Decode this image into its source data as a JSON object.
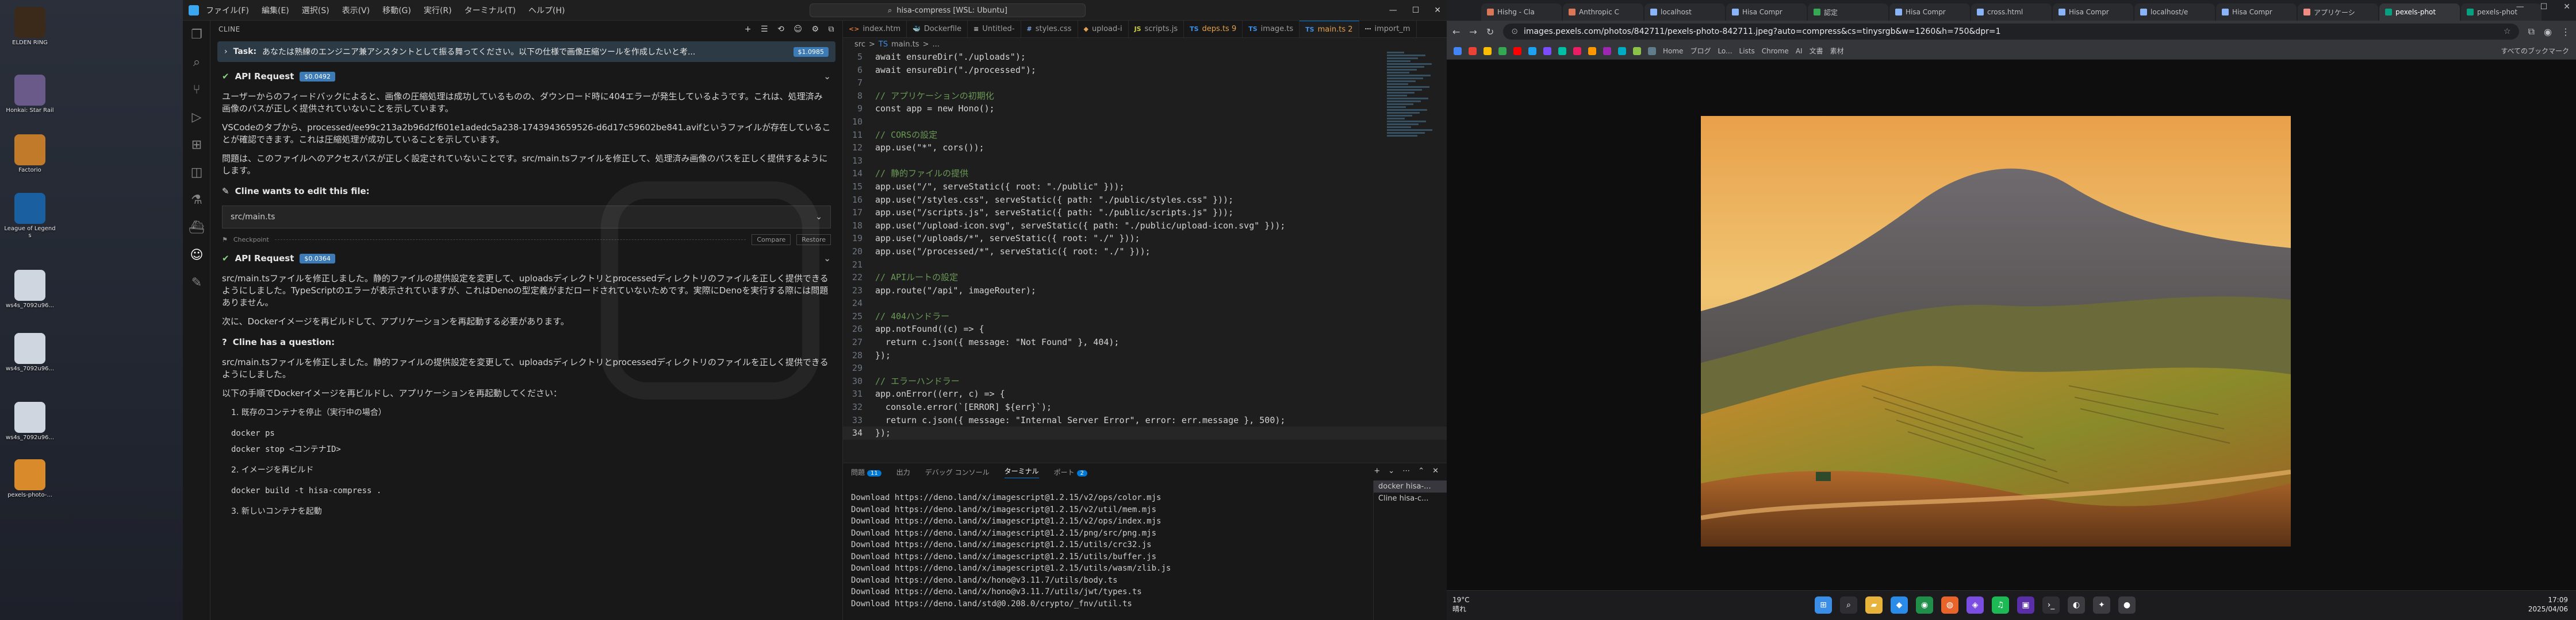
{
  "desktop": {
    "icons": [
      {
        "label": "ELDEN RING",
        "color": "#3b2a1a"
      },
      {
        "label": "Honkai: Star Rail",
        "color": "#6a5a8a"
      },
      {
        "label": "Factorio",
        "color": "#c07a2a"
      },
      {
        "label": "League of Legends",
        "color": "#1a5fa0"
      },
      {
        "label": "ws4s_7092u96...",
        "color": "#cfd6df"
      },
      {
        "label": "ws4s_7092u96...",
        "color": "#cfd6df"
      },
      {
        "label": "ws4s_7092u96...",
        "color": "#cfd6df"
      },
      {
        "label": "pexels-photo-...",
        "color": "#d98a2a"
      }
    ]
  },
  "vscode": {
    "menu": [
      "ファイル(F)",
      "編集(E)",
      "選択(S)",
      "表示(V)",
      "移動(G)",
      "実行(R)",
      "ターミナル(T)",
      "ヘルプ(H)"
    ],
    "search": "hisa-compress [WSL: Ubuntu]",
    "cline": {
      "header": "CLINE",
      "task_label": "Task:",
      "task_text": "あなたは熟練のエンジニア兼アシスタントとして振る舞ってください。以下の仕様で画像圧縮ツールを作成したいと考...",
      "task_tokens": "$1.0985",
      "api1_label": "API Request",
      "api1_cost": "$0.0492",
      "p1": "ユーザーからのフィードバックによると、画像の圧縮処理は成功しているものの、ダウンロード時に404エラーが発生しているようです。これは、処理済み画像のパスが正しく提供されていないことを示しています。",
      "p2": "VSCodeのタブから、processed/ee99c213a2b96d2f601e1adedc5a238-1743943659526-d6d17c59602be841.avifというファイルが存在していることが確認できます。これは圧縮処理が成功していることを示しています。",
      "p3": "問題は、このファイルへのアクセスパスが正しく設定されていないことです。src/main.tsファイルを修正して、処理済み画像のパスを正しく提供するようにします。",
      "edit_title": "Cline wants to edit this file:",
      "edit_file": "src/main.ts",
      "checkpoint": "Checkpoint",
      "compare": "Compare",
      "restore": "Restore",
      "api2_label": "API Request",
      "api2_cost": "$0.0364",
      "p4": "src/main.tsファイルを修正しました。静的ファイルの提供設定を変更して、uploadsディレクトリとprocessedディレクトリのファイルを正しく提供できるようにしました。TypeScriptのエラーが表示されていますが、これはDenoの型定義がまだロードされていないためです。実際にDenoを実行する際には問題ありません。",
      "p5": "次に、Dockerイメージを再ビルドして、アプリケーションを再起動する必要があります。",
      "q_title": "Cline has a question:",
      "p6": "src/main.tsファイルを修正しました。静的ファイルの提供設定を変更して、uploadsディレクトリとprocessedディレクトリのファイルを正しく提供できるようにしました。",
      "p7": "以下の手順でDockerイメージを再ビルドし、アプリケーションを再起動してください：",
      "s1": "1. 既存のコンテナを停止（実行中の場合）",
      "c1a": "docker ps",
      "c1b": "docker stop <コンテナID>",
      "s2": "2. イメージを再ビルド",
      "c2": "docker build -t hisa-compress .",
      "s3": "3. 新しいコンテナを起動"
    },
    "tabs": [
      {
        "icon": "<>",
        "icon_color": "#e37933",
        "label": "index.htm"
      },
      {
        "icon": "🐳",
        "icon_color": "#3b8eea",
        "label": "Dockerfile"
      },
      {
        "icon": "≡",
        "icon_color": "#cccccc",
        "label": "Untitled-"
      },
      {
        "icon": "#",
        "icon_color": "#7ca2e0",
        "label": "styles.css"
      },
      {
        "icon": "◆",
        "icon_color": "#e0a050",
        "label": "upload-i"
      },
      {
        "icon": "JS",
        "icon_color": "#cbcb41",
        "label": "scripts.js"
      },
      {
        "icon": "TS",
        "icon_color": "#3b8eea",
        "label": "deps.ts 9"
      },
      {
        "icon": "TS",
        "icon_color": "#3b8eea",
        "label": "image.ts"
      },
      {
        "icon": "TS",
        "icon_color": "#3b8eea",
        "label": "main.ts 2"
      },
      {
        "icon": "⋯",
        "icon_color": "#cccccc",
        "label": "import_m"
      }
    ],
    "breadcrumb": [
      "src",
      ">",
      "TS",
      "main.ts",
      ">",
      "..."
    ],
    "code": [
      {
        "n": "5",
        "t": "await ensureDir(\"./uploads\");"
      },
      {
        "n": "6",
        "t": "await ensureDir(\"./processed\");"
      },
      {
        "n": "7",
        "t": ""
      },
      {
        "n": "8",
        "t": "// アプリケーションの初期化"
      },
      {
        "n": "9",
        "t": "const app = new Hono();"
      },
      {
        "n": "10",
        "t": ""
      },
      {
        "n": "11",
        "t": "// CORSの設定"
      },
      {
        "n": "12",
        "t": "app.use(\"*\", cors());"
      },
      {
        "n": "13",
        "t": ""
      },
      {
        "n": "14",
        "t": "// 静的ファイルの提供"
      },
      {
        "n": "15",
        "t": "app.use(\"/\", serveStatic({ root: \"./public\" }));"
      },
      {
        "n": "16",
        "t": "app.use(\"/styles.css\", serveStatic({ path: \"./public/styles.css\" }));"
      },
      {
        "n": "17",
        "t": "app.use(\"/scripts.js\", serveStatic({ path: \"./public/scripts.js\" }));"
      },
      {
        "n": "18",
        "t": "app.use(\"/upload-icon.svg\", serveStatic({ path: \"./public/upload-icon.svg\" }));"
      },
      {
        "n": "19",
        "t": "app.use(\"/uploads/*\", serveStatic({ root: \"./\" }));"
      },
      {
        "n": "20",
        "t": "app.use(\"/processed/*\", serveStatic({ root: \"./\" }));"
      },
      {
        "n": "21",
        "t": ""
      },
      {
        "n": "22",
        "t": "// APIルートの設定"
      },
      {
        "n": "23",
        "t": "app.route(\"/api\", imageRouter);"
      },
      {
        "n": "24",
        "t": ""
      },
      {
        "n": "25",
        "t": "// 404ハンドラー"
      },
      {
        "n": "26",
        "t": "app.notFound((c) => {"
      },
      {
        "n": "27",
        "t": "  return c.json({ message: \"Not Found\" }, 404);"
      },
      {
        "n": "28",
        "t": "});"
      },
      {
        "n": "29",
        "t": ""
      },
      {
        "n": "30",
        "t": "// エラーハンドラー"
      },
      {
        "n": "31",
        "t": "app.onError((err, c) => {"
      },
      {
        "n": "32",
        "t": "  console.error(`[ERROR] ${err}`);"
      },
      {
        "n": "33",
        "t": "  return c.json({ message: \"Internal Server Error\", error: err.message }, 500);"
      },
      {
        "n": "34",
        "t": "});"
      }
    ],
    "panel": {
      "tabs": [
        "問題",
        "出力",
        "デバッグ コンソール",
        "ターミナル",
        "ポート"
      ],
      "problems_count": "11",
      "ports_count": "2",
      "terminal_lines": [
        "Download https://deno.land/x/imagescript@1.2.15/v2/ops/color.mjs",
        "Download https://deno.land/x/imagescript@1.2.15/v2/util/mem.mjs",
        "Download https://deno.land/x/imagescript@1.2.15/v2/ops/index.mjs",
        "Download https://deno.land/x/imagescript@1.2.15/png/src/png.mjs",
        "Download https://deno.land/x/imagescript@1.2.15/utils/crc32.js",
        "Download https://deno.land/x/imagescript@1.2.15/utils/buffer.js",
        "Download https://deno.land/x/imagescript@1.2.15/utils/wasm/zlib.js",
        "Download https://deno.land/x/hono@v3.11.7/utils/body.ts",
        "Download https://deno.land/x/hono@v3.11.7/utils/jwt/types.ts",
        "Download https://deno.land/std@0.208.0/crypto/_fnv/util.ts"
      ],
      "terminal_list": [
        "docker hisa-...",
        "Cline hisa-c..."
      ]
    }
  },
  "browser": {
    "tabs": [
      {
        "label": "Hishg - Cla",
        "color": "#d97757"
      },
      {
        "label": "Anthropic C",
        "color": "#d97757"
      },
      {
        "label": "localhost",
        "color": "#8ab4f8"
      },
      {
        "label": "Hisa Compr",
        "color": "#8ab4f8"
      },
      {
        "label": "認定",
        "color": "#34a853"
      },
      {
        "label": "Hisa Compr",
        "color": "#8ab4f8"
      },
      {
        "label": "cross.html",
        "color": "#8ab4f8"
      },
      {
        "label": "Hisa Compr",
        "color": "#8ab4f8"
      },
      {
        "label": "localhost/e",
        "color": "#8ab4f8"
      },
      {
        "label": "Hisa Compr",
        "color": "#8ab4f8"
      },
      {
        "label": "アプリケーシ",
        "color": "#f28b82"
      },
      {
        "label": "pexels-phot",
        "color": "#07a081"
      },
      {
        "label": "pexels-phot",
        "color": "#07a081"
      }
    ],
    "active_tab": 11,
    "url": "images.pexels.com/photos/842711/pexels-photo-842711.jpeg?auto=compress&cs=tinysrgb&w=1260&h=750&dpr=1",
    "bookmarks": [
      "Home",
      "ブログ",
      "Lo...",
      "Lists",
      "Chrome",
      "AI",
      "文書",
      "素材",
      "すべてのブックマーク"
    ],
    "bookmark_colors": [
      "#4285f4",
      "#ea4335",
      "#fbbc04",
      "#34a853",
      "#ff0000",
      "#1da1f2",
      "#7c4dff",
      "#00bfa5",
      "#e91e63",
      "#ff9800",
      "#9c27b0",
      "#00acc1",
      "#8bc34a",
      "#607d8b"
    ]
  },
  "taskbar": {
    "temp": "19°C",
    "weather": "晴れ",
    "time": "17:09",
    "date": "2025/04/06",
    "icons": [
      {
        "name": "windows-start-icon",
        "color": "#3a8ee6",
        "glyph": "⊞"
      },
      {
        "name": "search-icon",
        "color": "#2f2f33",
        "glyph": "⌕"
      },
      {
        "name": "file-explorer-icon",
        "color": "#e8b33a",
        "glyph": "▰"
      },
      {
        "name": "vscode-taskbar-icon",
        "color": "#2a8be8",
        "glyph": "◆"
      },
      {
        "name": "chrome-icon",
        "color": "#1f8f4a",
        "glyph": "◉"
      },
      {
        "name": "firefox-icon",
        "color": "#e8642a",
        "glyph": "◍"
      },
      {
        "name": "app-icon",
        "color": "#7b4de0",
        "glyph": "◈"
      },
      {
        "name": "spotify-icon",
        "color": "#1db954",
        "glyph": "♫"
      },
      {
        "name": "app-icon-2",
        "color": "#5a2ea6",
        "glyph": "▣"
      },
      {
        "name": "terminal-icon",
        "color": "#2f2f33",
        "glyph": "›_"
      },
      {
        "name": "app-icon-3",
        "color": "#3c3c40",
        "glyph": "◐"
      },
      {
        "name": "app-icon-4",
        "color": "#3c3c40",
        "glyph": "✦"
      },
      {
        "name": "app-icon-5",
        "color": "#3c3c40",
        "glyph": "●"
      }
    ]
  }
}
